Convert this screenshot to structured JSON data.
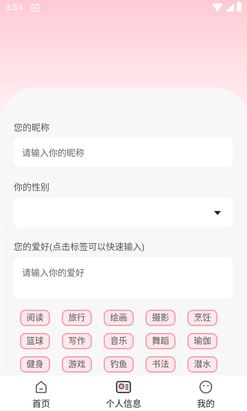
{
  "status_bar": {
    "time": "3:54"
  },
  "form": {
    "nickname_label": "您的昵称",
    "nickname_placeholder": "请输入你的昵称",
    "gender_label": "你的性别",
    "gender_value": "",
    "hobby_label": "您的爱好(点击标签可以快速输入)",
    "hobby_placeholder": "请输入你的爱好"
  },
  "tags": [
    "阅读",
    "旅行",
    "绘画",
    "摄影",
    "烹饪",
    "篮球",
    "写作",
    "音乐",
    "舞蹈",
    "瑜伽",
    "健身",
    "游戏",
    "钓鱼",
    "书法",
    "潜水"
  ],
  "bottom_nav": {
    "items": [
      {
        "label": "首页",
        "icon": "home-icon"
      },
      {
        "label": "个人信息",
        "icon": "profile-card-icon"
      },
      {
        "label": "我的",
        "icon": "smile-face-icon"
      }
    ]
  },
  "colors": {
    "accent": "#f2a6b4",
    "tag_bg": "#fde8ec",
    "header_pink": "#ffc9d3"
  }
}
